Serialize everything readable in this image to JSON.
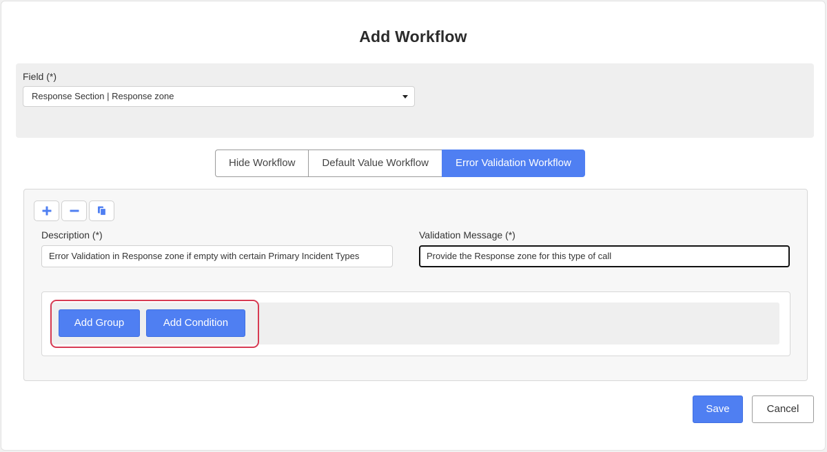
{
  "dialog": {
    "title": "Add Workflow"
  },
  "field": {
    "label": "Field (*)",
    "selected": "Response Section | Response zone"
  },
  "tabs": [
    {
      "label": "Hide Workflow",
      "active": false
    },
    {
      "label": "Default Value Workflow",
      "active": false
    },
    {
      "label": "Error Validation Workflow",
      "active": true
    }
  ],
  "toolbar": {
    "add_icon": "plus-icon",
    "remove_icon": "minus-icon",
    "copy_icon": "copy-icon"
  },
  "description": {
    "label": "Description (*)",
    "value": "Error Validation in Response zone if empty with certain Primary Incident Types"
  },
  "validation_message": {
    "label": "Validation Message (*)",
    "value": "Provide the Response zone for this type of call"
  },
  "rules": {
    "add_group_label": "Add Group",
    "add_condition_label": "Add Condition"
  },
  "footer": {
    "save_label": "Save",
    "cancel_label": "Cancel"
  },
  "colors": {
    "accent": "#4f7ff2",
    "highlight": "#d73a52"
  }
}
